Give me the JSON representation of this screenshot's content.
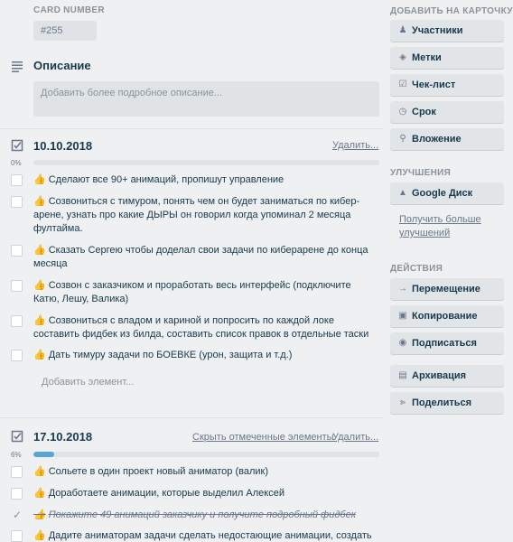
{
  "card_number": {
    "label": "CARD NUMBER",
    "value": "#255"
  },
  "description": {
    "title": "Описание",
    "placeholder": "Добавить более подробное описание..."
  },
  "checklists": [
    {
      "title": "10.10.2018",
      "delete_label": "Удалить...",
      "progress_text": "0%",
      "progress": 0,
      "items": [
        {
          "text": "Сделают все 90+ анимаций, пропишут управление",
          "checked": false
        },
        {
          "text": "Созвониться с тимуром, понять чем он будет заниматься по кибер-арене, узнать про какие ДЫРЫ он говорил когда упоминал 2 месяца фултайма.",
          "checked": false
        },
        {
          "text": "Сказать Сергею чтобы доделал свои задачи по киберарене до конца месяца",
          "checked": false
        },
        {
          "text": "Созвон с заказчиком и проработать весь интерфейс (подключите Катю, Лешу, Валика)",
          "checked": false
        },
        {
          "text": "Созвониться с владом и кариной и попросить по каждой локе составить фидбек из билда, составить список правок в отдельные таски",
          "checked": false
        },
        {
          "text": "Дать тимуру задачи по БОЕВКЕ (урон, защита и т.д.)",
          "checked": false
        }
      ],
      "add_item_label": "Добавить элемент..."
    },
    {
      "title": "17.10.2018",
      "hide_checked_label": "Скрыть отмеченные элементы",
      "delete_label": "Удалить...",
      "progress_text": "6%",
      "progress": 0.06,
      "items": [
        {
          "text": "Сольете в один проект новый аниматор (валик)",
          "checked": false
        },
        {
          "text": "Доработаете анимации, которые выделил Алексей",
          "checked": false
        },
        {
          "text": "Покажите 49 анимаций заказчику и получите подробный фидбек",
          "checked": true
        },
        {
          "text": "Дадите аниматорам задачи сделать недостающие анимации, создать",
          "checked": false
        }
      ]
    }
  ],
  "sidebar": {
    "add_label": "ДОБАВИТЬ НА КАРТОЧКУ",
    "add_buttons": [
      {
        "label": "Участники",
        "icon": "person-icon"
      },
      {
        "label": "Метки",
        "icon": "tag-icon"
      },
      {
        "label": "Чек-лист",
        "icon": "checklist-icon"
      },
      {
        "label": "Срок",
        "icon": "clock-icon"
      },
      {
        "label": "Вложение",
        "icon": "paperclip-icon"
      }
    ],
    "powerups_label": "УЛУЧШЕНИЯ",
    "powerup_buttons": [
      {
        "label": "Google Диск",
        "icon": "google-drive-icon"
      }
    ],
    "more_powerups_link": "Получить больше улучшений",
    "actions_label": "ДЕЙСТВИЯ",
    "action_buttons": [
      {
        "label": "Перемещение",
        "icon": "arrow-right-icon"
      },
      {
        "label": "Копирование",
        "icon": "copy-icon"
      },
      {
        "label": "Подписаться",
        "icon": "eye-icon"
      },
      {
        "label": "Архивация",
        "icon": "archive-icon"
      },
      {
        "label": "Поделиться",
        "icon": "share-icon"
      }
    ]
  },
  "colors": {
    "background": "#eef0f2",
    "progress_fill": "#5ba4cf",
    "text": "#17394d",
    "muted": "#8a939b"
  }
}
